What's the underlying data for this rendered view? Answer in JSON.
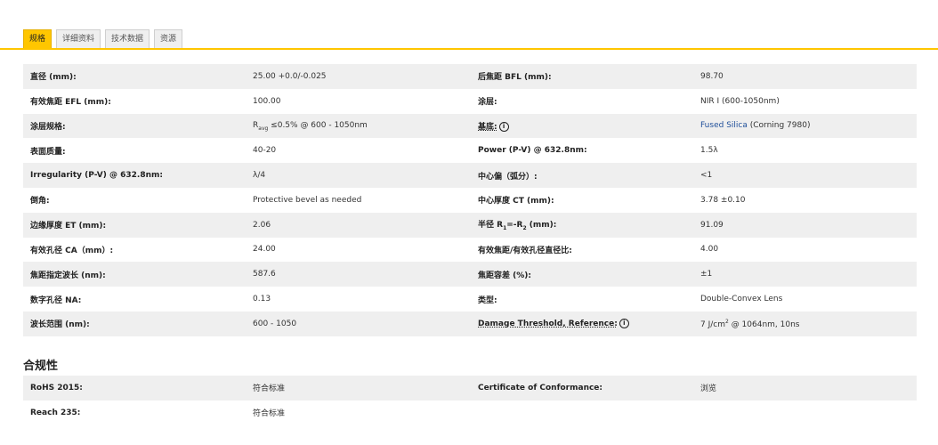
{
  "tabs": [
    {
      "label": "规格",
      "active": true
    },
    {
      "label": "详细资料",
      "active": false
    },
    {
      "label": "技术数据",
      "active": false
    },
    {
      "label": "资源",
      "active": false
    }
  ],
  "specs": {
    "diameter_label": "直径 (mm):",
    "diameter_value": "25.00 +0.0/-0.025",
    "bfl_label": "后焦距 BFL (mm):",
    "bfl_value": "98.70",
    "efl_label": "有效焦距 EFL (mm):",
    "efl_value": "100.00",
    "coating_label": "涂层:",
    "coating_value": "NIR I (600-1050nm)",
    "coating_spec_label": "涂层规格:",
    "coating_spec_r": "R",
    "coating_spec_sub": "avg",
    "coating_spec_rest": " ≤0.5% @ 600 - 1050nm",
    "substrate_label": "基底:",
    "substrate_info": "i",
    "substrate_link": "Fused Silica",
    "substrate_rest": " (Corning 7980)",
    "surface_quality_label": "表面质量:",
    "surface_quality_value": "40-20",
    "power_label": "Power (P-V) @ 632.8nm:",
    "power_value": "1.5λ",
    "irregularity_label": "Irregularity (P-V) @ 632.8nm:",
    "irregularity_value": "λ/4",
    "centering_label": "中心偏（弧分）:",
    "centering_value": "<1",
    "bevel_label": "倒角:",
    "bevel_value": "Protective bevel as needed",
    "ct_label": "中心厚度 CT (mm):",
    "ct_value": "3.78 ±0.10",
    "et_label": "边缘厚度 ET (mm):",
    "et_value": "2.06",
    "radius_label_pre": "半径 R",
    "radius_sub1": "1",
    "radius_label_mid": "=-R",
    "radius_sub2": "2",
    "radius_label_post": " (mm):",
    "radius_value": "91.09",
    "ca_label": "有效孔径 CA（mm）:",
    "ca_value": "24.00",
    "f_number_label": "有效焦距/有效孔径直径比:",
    "f_number_value": "4.00",
    "design_wavelength_label": "焦距指定波长 (nm):",
    "design_wavelength_value": "587.6",
    "focal_tolerance_label": "焦距容差 (%):",
    "focal_tolerance_value": "±1",
    "na_label": "数字孔径 NA:",
    "na_value": "0.13",
    "type_label": "类型:",
    "type_value": "Double-Convex Lens",
    "wavelength_range_label": "波长范围 (nm):",
    "wavelength_range_value": "600 - 1050",
    "damage_label": "Damage Threshold, Reference:",
    "damage_info": "i",
    "damage_value_pre": "7 J/cm",
    "damage_sup": "2",
    "damage_value_post": " @ 1064nm, 10ns"
  },
  "compliance": {
    "title": "合规性",
    "rohs_label": "RoHS 2015:",
    "rohs_value": "符合标准",
    "cert_label": "Certificate of Conformance:",
    "cert_value": "浏览",
    "reach_label": "Reach 235:",
    "reach_value": "符合标准"
  }
}
